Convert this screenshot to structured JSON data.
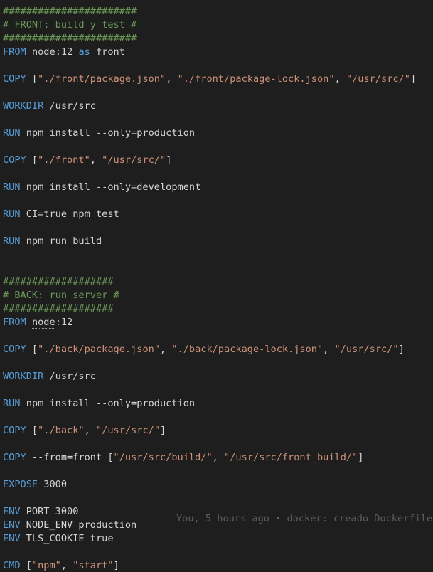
{
  "colors": {
    "background": "#1e1e1e",
    "comment": "#6a9955",
    "keyword": "#569cd6",
    "string": "#ce9178",
    "plain": "#d4d4d4",
    "blame": "#5e5e5e"
  },
  "editor": {
    "language": "Dockerfile",
    "lines": [
      [
        {
          "t": "comment",
          "v": "#######################"
        }
      ],
      [
        {
          "t": "comment",
          "v": "# FRONT: build y test #"
        }
      ],
      [
        {
          "t": "comment",
          "v": "#######################"
        }
      ],
      [
        {
          "t": "keyword",
          "v": "FROM"
        },
        {
          "t": "plain",
          "v": " "
        },
        {
          "t": "image",
          "v": "node"
        },
        {
          "t": "plain",
          "v": ":12 "
        },
        {
          "t": "keyword",
          "v": "as"
        },
        {
          "t": "plain",
          "v": " front"
        }
      ],
      [],
      [
        {
          "t": "keyword",
          "v": "COPY"
        },
        {
          "t": "plain",
          "v": " ["
        },
        {
          "t": "string",
          "v": "\"./front/package.json\""
        },
        {
          "t": "plain",
          "v": ", "
        },
        {
          "t": "string",
          "v": "\"./front/package-lock.json\""
        },
        {
          "t": "plain",
          "v": ", "
        },
        {
          "t": "string",
          "v": "\"/usr/src/\""
        },
        {
          "t": "plain",
          "v": "]"
        }
      ],
      [],
      [
        {
          "t": "keyword",
          "v": "WORKDIR"
        },
        {
          "t": "plain",
          "v": " /usr/src"
        }
      ],
      [],
      [
        {
          "t": "keyword",
          "v": "RUN"
        },
        {
          "t": "plain",
          "v": " npm install --only=production"
        }
      ],
      [],
      [
        {
          "t": "keyword",
          "v": "COPY"
        },
        {
          "t": "plain",
          "v": " ["
        },
        {
          "t": "string",
          "v": "\"./front\""
        },
        {
          "t": "plain",
          "v": ", "
        },
        {
          "t": "string",
          "v": "\"/usr/src/\""
        },
        {
          "t": "plain",
          "v": "]"
        }
      ],
      [],
      [
        {
          "t": "keyword",
          "v": "RUN"
        },
        {
          "t": "plain",
          "v": " npm install --only=development"
        }
      ],
      [],
      [
        {
          "t": "keyword",
          "v": "RUN"
        },
        {
          "t": "plain",
          "v": " CI=true npm test"
        }
      ],
      [],
      [
        {
          "t": "keyword",
          "v": "RUN"
        },
        {
          "t": "plain",
          "v": " npm run build"
        }
      ],
      [],
      [],
      [
        {
          "t": "comment",
          "v": "###################"
        }
      ],
      [
        {
          "t": "comment",
          "v": "# BACK: run server #"
        }
      ],
      [
        {
          "t": "comment",
          "v": "###################"
        }
      ],
      [
        {
          "t": "keyword",
          "v": "FROM"
        },
        {
          "t": "plain",
          "v": " "
        },
        {
          "t": "image",
          "v": "node"
        },
        {
          "t": "plain",
          "v": ":12"
        }
      ],
      [],
      [
        {
          "t": "keyword",
          "v": "COPY"
        },
        {
          "t": "plain",
          "v": " ["
        },
        {
          "t": "string",
          "v": "\"./back/package.json\""
        },
        {
          "t": "plain",
          "v": ", "
        },
        {
          "t": "string",
          "v": "\"./back/package-lock.json\""
        },
        {
          "t": "plain",
          "v": ", "
        },
        {
          "t": "string",
          "v": "\"/usr/src/\""
        },
        {
          "t": "plain",
          "v": "]"
        }
      ],
      [],
      [
        {
          "t": "keyword",
          "v": "WORKDIR"
        },
        {
          "t": "plain",
          "v": " /usr/src"
        }
      ],
      [],
      [
        {
          "t": "keyword",
          "v": "RUN"
        },
        {
          "t": "plain",
          "v": " npm install --only=production"
        }
      ],
      [],
      [
        {
          "t": "keyword",
          "v": "COPY"
        },
        {
          "t": "plain",
          "v": " ["
        },
        {
          "t": "string",
          "v": "\"./back\""
        },
        {
          "t": "plain",
          "v": ", "
        },
        {
          "t": "string",
          "v": "\"/usr/src/\""
        },
        {
          "t": "plain",
          "v": "]"
        }
      ],
      [],
      [
        {
          "t": "keyword",
          "v": "COPY"
        },
        {
          "t": "plain",
          "v": " --from=front ["
        },
        {
          "t": "string",
          "v": "\"/usr/src/build/\""
        },
        {
          "t": "plain",
          "v": ", "
        },
        {
          "t": "string",
          "v": "\"/usr/src/front_build/\""
        },
        {
          "t": "plain",
          "v": "]"
        }
      ],
      [],
      [
        {
          "t": "keyword",
          "v": "EXPOSE"
        },
        {
          "t": "plain",
          "v": " 3000"
        }
      ],
      [],
      [
        {
          "t": "keyword",
          "v": "ENV"
        },
        {
          "t": "plain",
          "v": " PORT 3000"
        }
      ],
      [
        {
          "t": "keyword",
          "v": "ENV"
        },
        {
          "t": "plain",
          "v": " NODE_ENV production"
        }
      ],
      [
        {
          "t": "keyword",
          "v": "ENV"
        },
        {
          "t": "plain",
          "v": " TLS_COOKIE true"
        }
      ],
      [],
      [
        {
          "t": "keyword",
          "v": "CMD"
        },
        {
          "t": "plain",
          "v": " ["
        },
        {
          "t": "string",
          "v": "\"npm\""
        },
        {
          "t": "plain",
          "v": ", "
        },
        {
          "t": "string",
          "v": "\"start\""
        },
        {
          "t": "plain",
          "v": "]"
        }
      ]
    ],
    "blame_annotation": "You, 5 hours ago • docker: creado Dockerfile"
  }
}
